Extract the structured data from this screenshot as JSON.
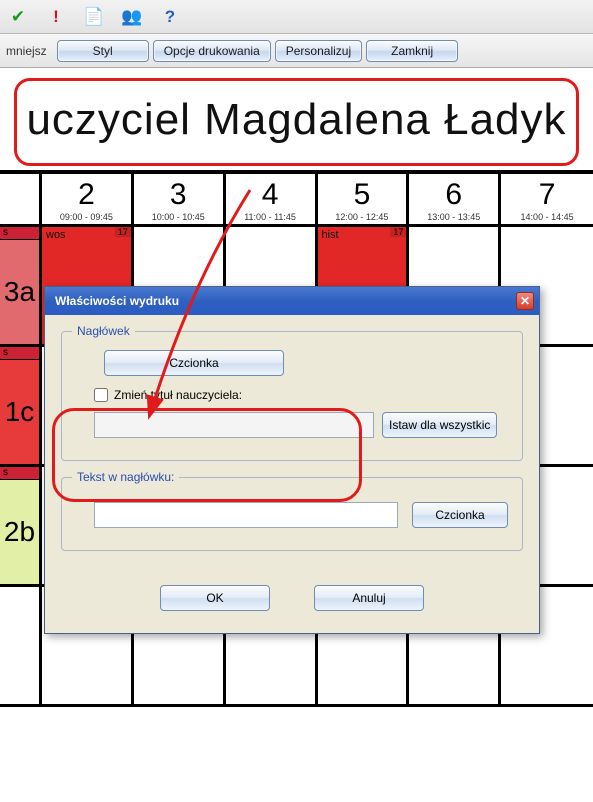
{
  "toolbar": {
    "mniejszesz": "mniejsz",
    "styl": "Styl",
    "opcje": "Opcje drukowania",
    "personalizuj": "Personalizuj",
    "zamknij": "Zamknij"
  },
  "title": "uczyciel Magdalena Ładyk",
  "columns": [
    {
      "num": "2",
      "time": "09:00 - 09:45"
    },
    {
      "num": "3",
      "time": "10:00 - 10:45"
    },
    {
      "num": "4",
      "time": "11:00 - 11:45"
    },
    {
      "num": "5",
      "time": "12:00 - 12:45"
    },
    {
      "num": "6",
      "time": "13:00 - 13:45"
    },
    {
      "num": "7",
      "time": "14:00 - 14:45"
    }
  ],
  "rows": [
    {
      "s": "s",
      "label": "3a",
      "cells": [
        {
          "red": true,
          "tag": "17",
          "sub": "wos"
        },
        {},
        {},
        {
          "red": true,
          "tag": "17",
          "sub": "hist"
        },
        {},
        {}
      ]
    },
    {
      "s": "s",
      "label": "1c",
      "cells": [
        {},
        {},
        {},
        {},
        {},
        {}
      ]
    },
    {
      "s": "s",
      "label": "2b",
      "cells": [
        {},
        {},
        {},
        {},
        {},
        {}
      ]
    },
    {
      "s": "",
      "label": "",
      "cells": [
        {},
        {},
        {},
        {},
        {},
        {}
      ]
    }
  ],
  "dialog": {
    "title": "Właściwości wydruku",
    "section1": "Nagłówek",
    "fontBtn": "Czcionka",
    "changeTitle": "Zmień tytuł nauczyciela:",
    "setAll": "Istaw dla wszystkic",
    "section2": "Tekst w nagłówku:",
    "fontBtn2": "Czcionka",
    "ok": "OK",
    "cancel": "Anuluj"
  }
}
